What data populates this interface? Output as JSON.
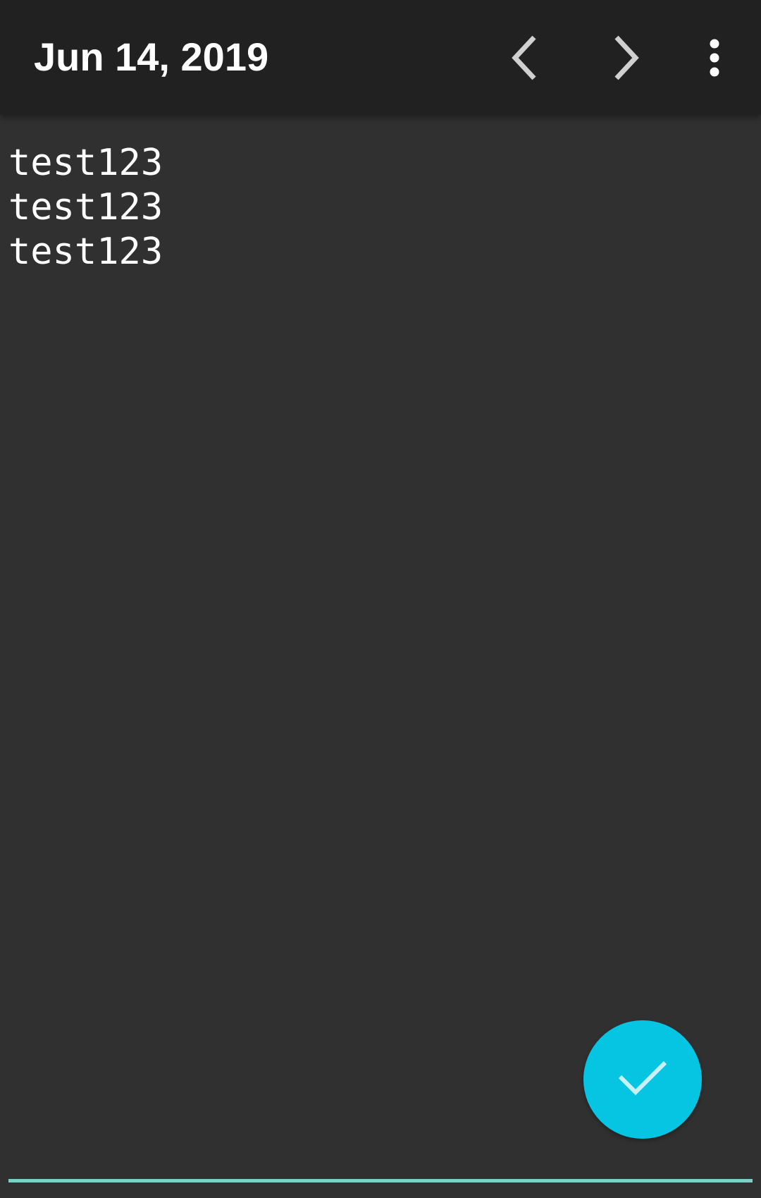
{
  "toolbar": {
    "title": "Jun 14, 2019",
    "prev_icon": "chevron-left-icon",
    "next_icon": "chevron-right-icon",
    "more_icon": "more-vertical-icon"
  },
  "editor": {
    "content": "test123\ntest123\ntest123"
  },
  "fab": {
    "icon": "check-icon"
  },
  "colors": {
    "toolbar_bg": "#212121",
    "content_bg": "#303030",
    "fab_bg": "#05c5e3",
    "underline": "#7fcdc4"
  }
}
